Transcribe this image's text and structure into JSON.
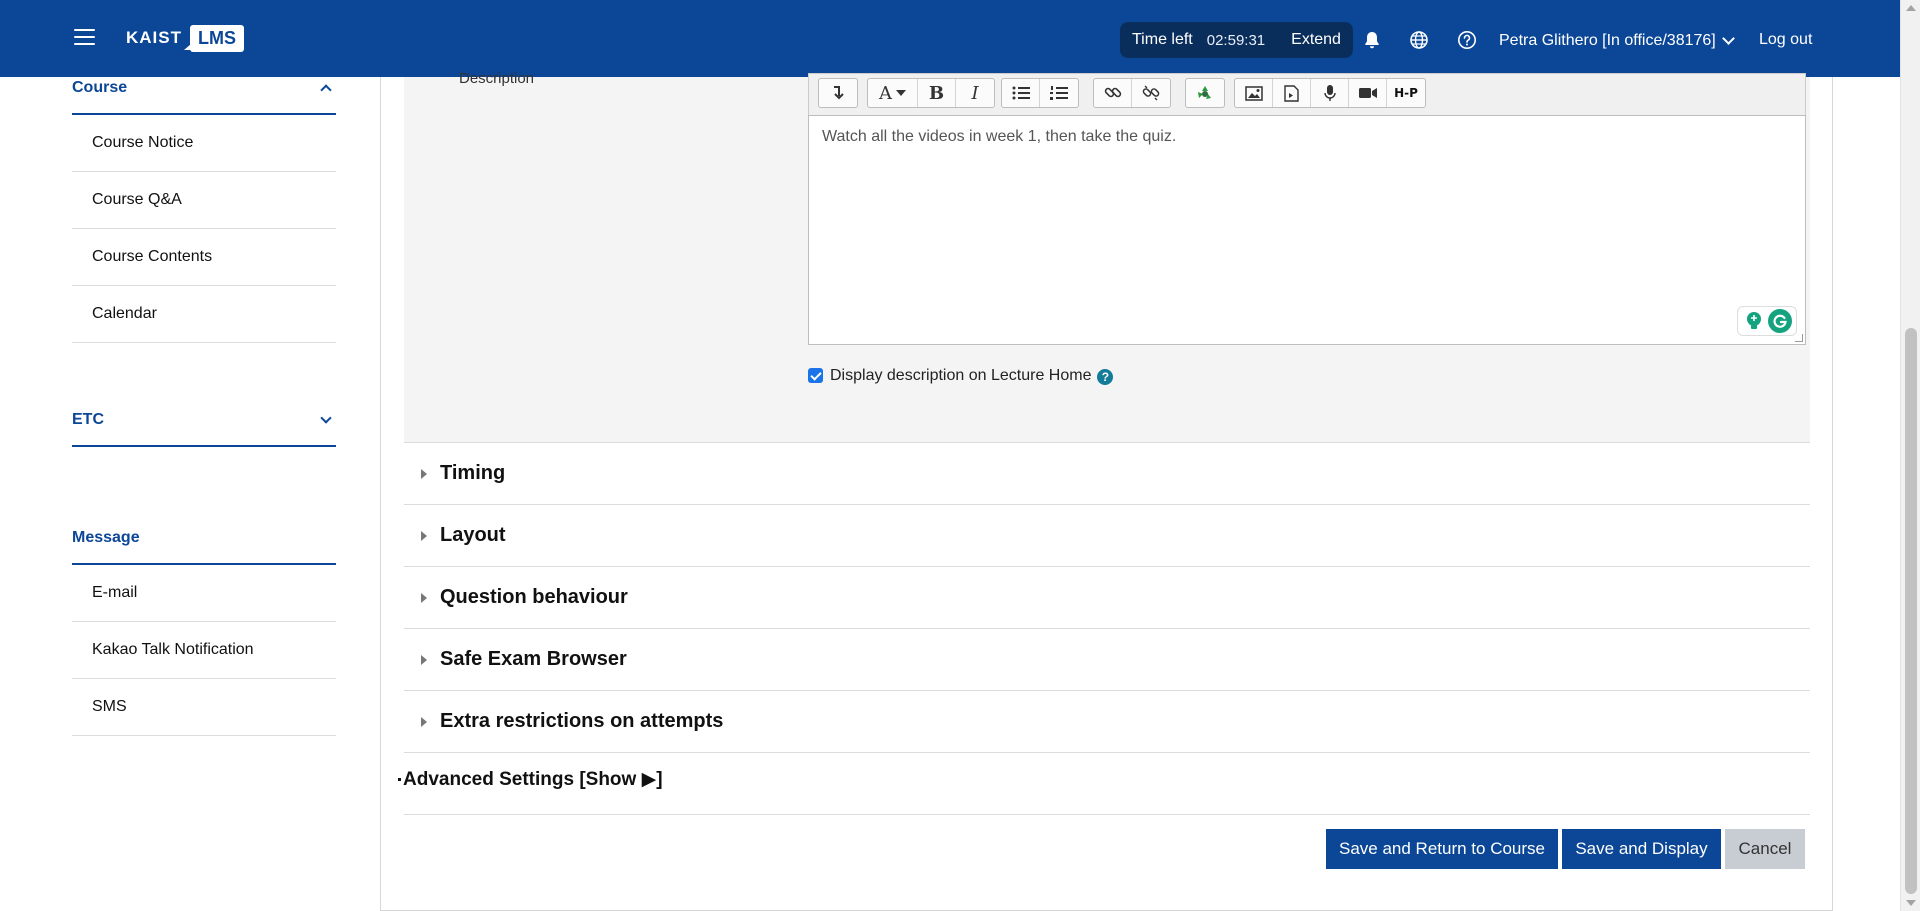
{
  "header": {
    "logo_left": "KAIST",
    "logo_right": "LMS",
    "timer_label": "Time left",
    "timer_value": "02:59:31",
    "extend_label": "Extend",
    "user_name": "Petra Glithero [In office/38176]",
    "logout_label": "Log out"
  },
  "sidebar": {
    "sections": [
      {
        "title": "Course",
        "expanded": true,
        "items": [
          "Course Notice",
          "Course Q&A",
          "Course Contents",
          "Calendar"
        ]
      },
      {
        "title": "ETC",
        "expanded": false,
        "items": []
      },
      {
        "title": "Message",
        "expanded": true,
        "items": [
          "E-mail",
          "Kakao Talk Notification",
          "SMS"
        ]
      }
    ]
  },
  "form": {
    "description_label": "Description",
    "description_text": "Watch all the videos in week 1, then take the quiz.",
    "display_checkbox_label": "Display description on Lecture Home",
    "display_checkbox_checked": true,
    "sections": [
      "Timing",
      "Layout",
      "Question behaviour",
      "Safe Exam Browser",
      "Extra restrictions on attempts"
    ],
    "advanced_label": "Advanced Settings [Show ▶]",
    "toolbar_hp_label": "H-P"
  },
  "buttons": {
    "save_return": "Save and Return to Course",
    "save_display": "Save and Display",
    "cancel": "Cancel"
  },
  "colors": {
    "brand": "#0b4697",
    "timer_bg": "#0a2e5c",
    "checkbox": "#1a73e8",
    "help_icon": "#137c9b",
    "grammarly": "#15a37f"
  }
}
